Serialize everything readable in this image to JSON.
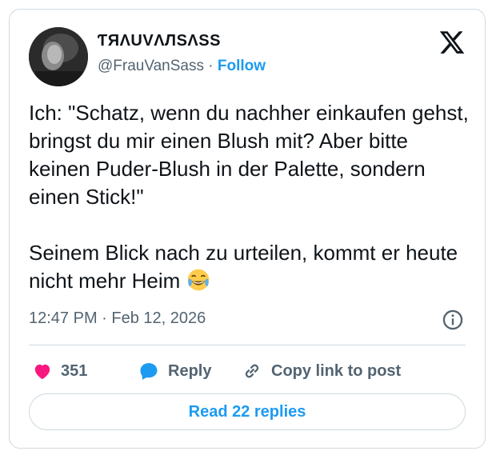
{
  "author": {
    "display_name": "ƬЯΛUVΛЛSΛSS",
    "handle": "@FrauVanSass",
    "separator": "·",
    "follow_label": "Follow"
  },
  "tweet": {
    "text": "Ich: \"Schatz, wenn du nachher einkaufen gehst, bringst du mir einen Blush mit? Aber bitte keinen Puder-Blush in der Palette, sondern einen Stick!\"\n\nSeinem Blick nach zu urteilen, kommt er heute nicht mehr Heim ",
    "emoji": "face-with-tears-of-joy",
    "timestamp": "12:47 PM · Feb 12, 2026"
  },
  "actions": {
    "like_count": "351",
    "reply_label": "Reply",
    "copy_link_label": "Copy link to post"
  },
  "footer": {
    "read_replies_label": "Read 22 replies"
  },
  "colors": {
    "accent": "#1d9bf0",
    "like": "#f91880",
    "secondary_text": "#536471",
    "border": "#cfd9de"
  }
}
